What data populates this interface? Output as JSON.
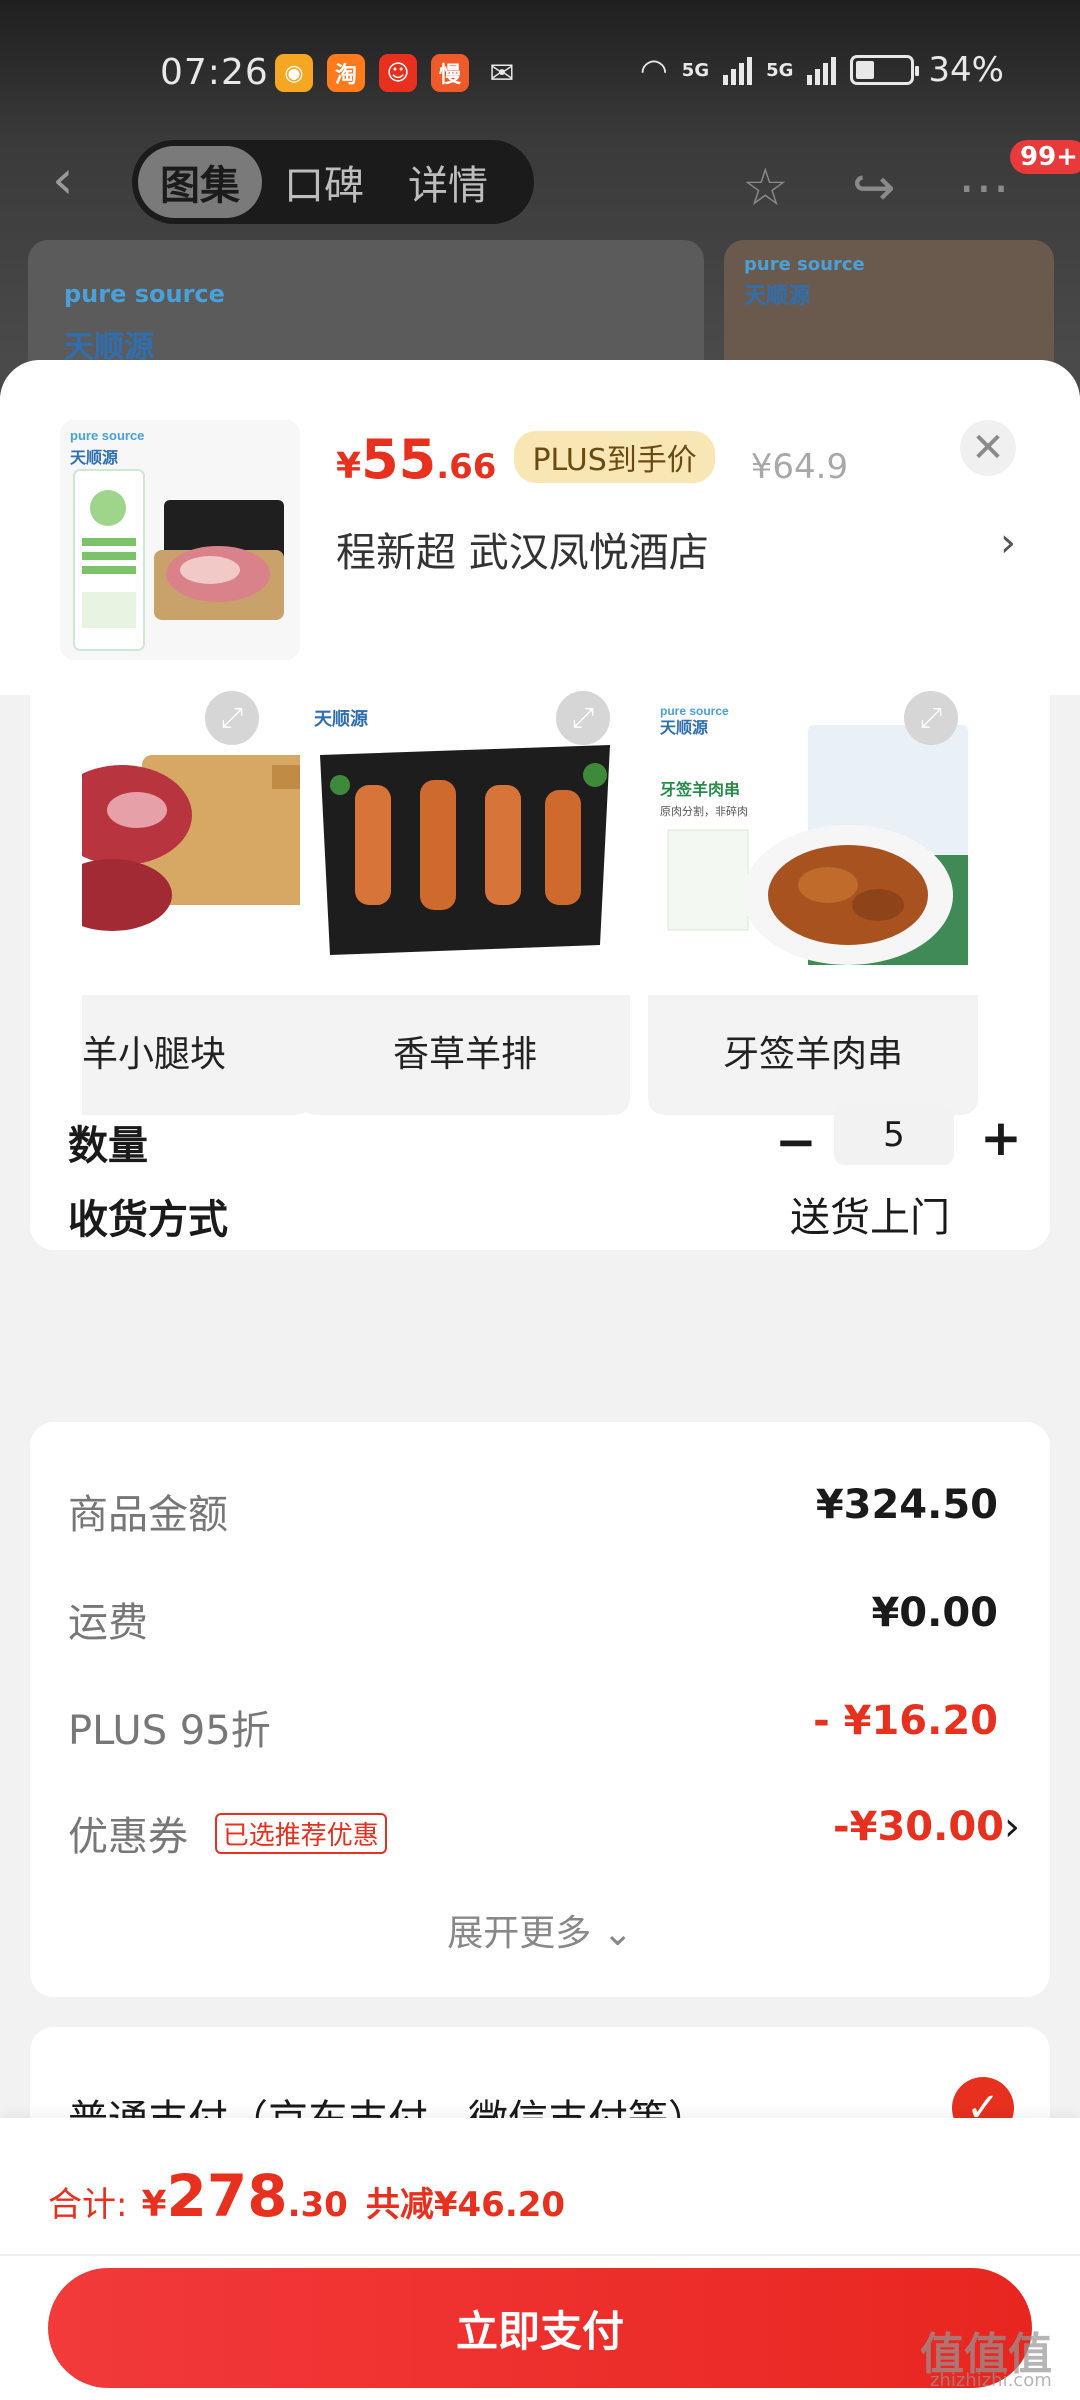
{
  "status_bar": {
    "time": "07:26",
    "battery": "34%",
    "network_1": "5G",
    "network_2": "5G",
    "app_icons": [
      "weibo-icon",
      "taobao-icon",
      "jd-icon",
      "app-icon",
      "wechat-icon"
    ]
  },
  "nav": {
    "tabs": [
      "图集",
      "口碑",
      "详情"
    ],
    "active_tab": 0,
    "badge": "99+"
  },
  "bg_product": {
    "brand_en": "pure source",
    "brand_cn": "天顺源"
  },
  "sheet": {
    "price": {
      "currency": "¥",
      "integer": "55",
      "decimal": ".66",
      "plus_tag": "PLUS到手价",
      "original": "¥64.9"
    },
    "store": "程新超  武汉凤悦酒店",
    "specs": [
      {
        "label": "羊小腿块"
      },
      {
        "label": "香草羊排"
      },
      {
        "label": "牙签羊肉串"
      }
    ],
    "thumb": {
      "brand_en": "pure source",
      "brand_cn": "天顺源"
    },
    "spec_image_text": {
      "brand_en": "pure source",
      "brand_cn": "天顺源",
      "kebab_title": "牙签羊肉串",
      "kebab_sub": "原肉分割，非碎肉"
    },
    "quantity": {
      "label": "数量",
      "minus": "−",
      "value": "5",
      "plus": "+"
    },
    "delivery": {
      "label": "收货方式",
      "value": "送货上门"
    },
    "price_detail": {
      "items": [
        {
          "key": "商品金额",
          "value": "¥324.50"
        },
        {
          "key": "运费",
          "value": "¥0.00"
        },
        {
          "key": "PLUS 95折",
          "value": "- ¥16.20"
        },
        {
          "key": "优惠券",
          "tag": "已选推荐优惠",
          "value": "-¥30.00"
        }
      ],
      "expand": "展开更多 ⌄"
    },
    "payment": {
      "label": "普通支付（京东支付、微信支付等）"
    }
  },
  "bottom": {
    "total_label": "合计:",
    "total_cur": "¥",
    "total_int": "278",
    "total_dec": ".30",
    "saved": "共减¥46.20",
    "pay_button": "立即支付"
  },
  "watermark": {
    "main": "值值值",
    "sub": "zhizhizhi.com"
  },
  "colors": {
    "accent": "#e8301f",
    "plus_tag_bg": "#f8e7b5"
  }
}
